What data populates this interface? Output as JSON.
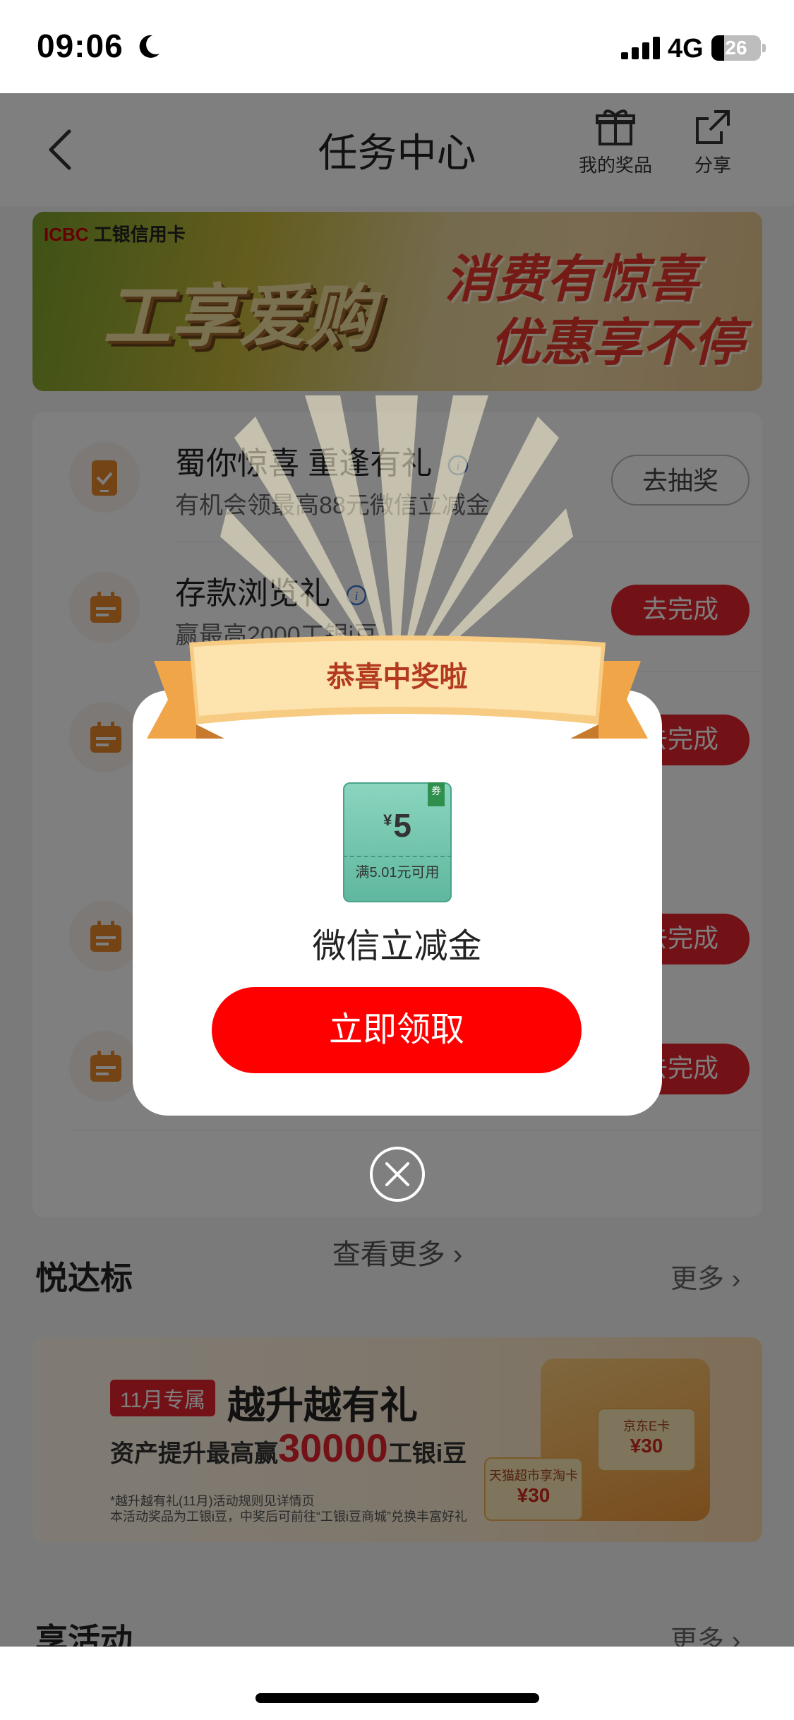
{
  "status_bar": {
    "time": "09:06",
    "network": "4G",
    "battery": "26"
  },
  "nav": {
    "title": "任务中心",
    "prizes_label": "我的奖品",
    "share_label": "分享"
  },
  "banner": {
    "bank_name": "ICBC",
    "card_name": "工银信用卡",
    "main_text": "工享爱购",
    "slogan_1": "消费有惊喜",
    "slogan_2": "优惠享不停"
  },
  "tasks": [
    {
      "title": "蜀你惊喜 重逢有礼",
      "desc": "有机会领最高88元微信立减金",
      "button": "去抽奖",
      "icon": "phone-check-icon"
    },
    {
      "title": "存款浏览礼",
      "desc": "赢最高2000工银i豆",
      "button": "去完成",
      "icon": "calendar-icon"
    },
    {
      "title": "",
      "desc": "",
      "button": "去完成",
      "icon": "calendar-icon"
    },
    {
      "title": "",
      "desc": "",
      "button": "去完成",
      "icon": "calendar-icon"
    },
    {
      "title": "",
      "desc": "",
      "button": "去完成",
      "icon": "calendar-icon"
    }
  ],
  "view_more": "查看更多",
  "section_1": {
    "title": "悦达标",
    "more": "更多"
  },
  "promo": {
    "badge": "11月专属",
    "title": "越升越有礼",
    "sub_prefix": "资产提升最高赢",
    "sub_amount": "30000",
    "sub_suffix": "工银i豆",
    "note_1": "*越升越有礼(11月)活动规则见详情页",
    "note_2": "本活动奖品为工银i豆，中奖后可前往“工银i豆商城”兑换丰富好礼",
    "card_1_label": "天猫超市享淘卡",
    "card_1_value": "¥30",
    "card_2_label": "京东E卡",
    "card_2_value": "¥30"
  },
  "section_2": {
    "title": "享活动",
    "more": "更多"
  },
  "modal": {
    "ribbon_title": "恭喜中奖啦",
    "coupon_tag": "券",
    "coupon_currency": "¥",
    "coupon_amount": "5",
    "coupon_condition": "满5.01元可用",
    "prize_name": "微信立减金",
    "claim_button": "立即领取"
  },
  "colors": {
    "accent_red": "#e4252c",
    "claim_red": "#ff0000",
    "coupon_green": "#5fb79e",
    "ribbon_gold": "#f5b35a"
  }
}
